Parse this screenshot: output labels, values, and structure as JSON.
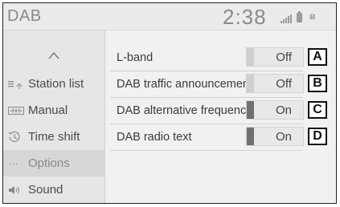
{
  "header": {
    "title": "DAB",
    "clock": "2:38"
  },
  "status_icons": [
    "signal-icon",
    "battery-icon",
    "bluetooth-icon"
  ],
  "sidebar": {
    "up_icon": "chevron-up-icon",
    "items": [
      {
        "label": "Station list",
        "icon": "station-list-icon",
        "active": false
      },
      {
        "label": "Manual",
        "icon": "manual-tuning-icon",
        "active": false
      },
      {
        "label": "Time shift",
        "icon": "time-shift-icon",
        "active": false
      },
      {
        "label": "Options",
        "icon": "more-icon",
        "active": true
      },
      {
        "label": "Sound",
        "icon": "speaker-icon",
        "active": false
      }
    ]
  },
  "options": [
    {
      "label": "L-band",
      "state": "Off",
      "callout": "A"
    },
    {
      "label": "DAB traffic announcement",
      "state": "Off",
      "callout": "B"
    },
    {
      "label": "DAB alternative frequency",
      "state": "On",
      "callout": "C"
    },
    {
      "label": "DAB radio text",
      "state": "On",
      "callout": "D"
    }
  ],
  "colors": {
    "accent_on": "#707070",
    "background": "#f1f1f1"
  }
}
